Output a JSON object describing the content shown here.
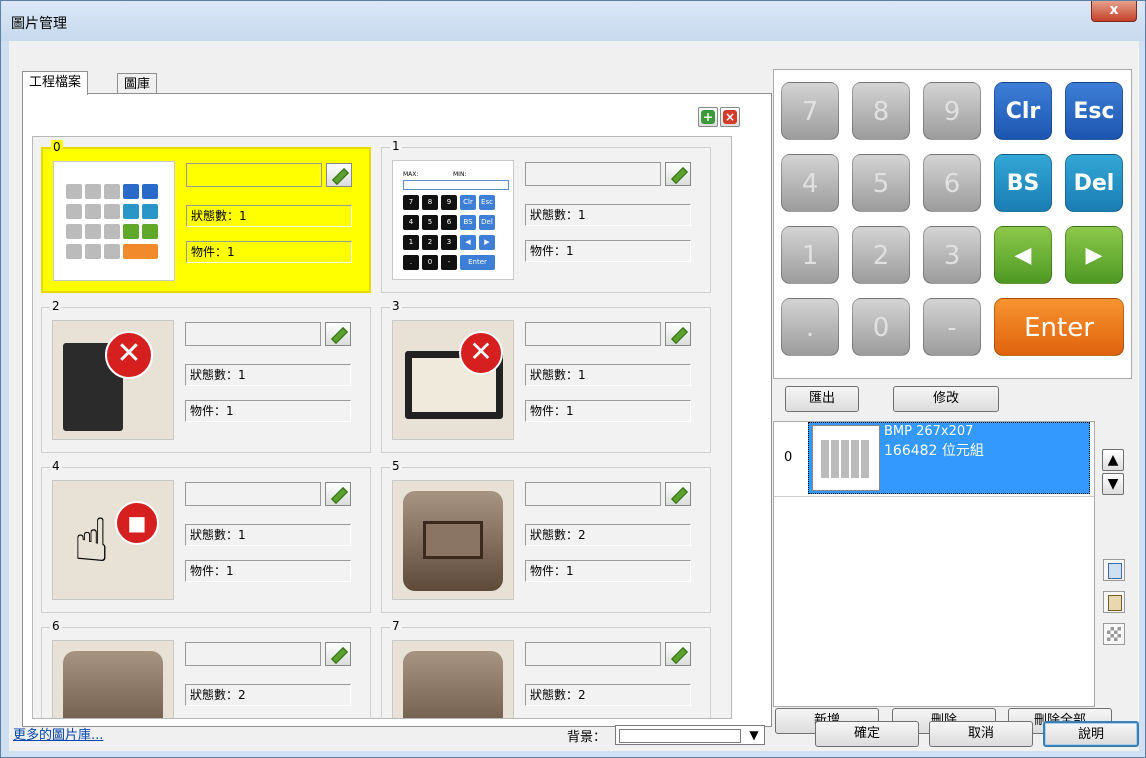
{
  "window": {
    "title": "圖片管理",
    "close_label": "x"
  },
  "tabs": [
    {
      "label": "工程檔案",
      "active": true
    },
    {
      "label": "圖庫",
      "active": false
    }
  ],
  "toolbar": {
    "add_icon": "add-image-icon",
    "remove_icon": "remove-image-icon"
  },
  "cards": [
    {
      "num": "0",
      "state_label": "狀態數：1",
      "object_label": "物件：1",
      "selected": true,
      "thumb": "keypad-gray"
    },
    {
      "num": "1",
      "state_label": "狀態數：1",
      "object_label": "物件：1",
      "selected": false,
      "thumb": "keypad-black"
    },
    {
      "num": "2",
      "state_label": "狀態數：1",
      "object_label": "物件：1",
      "selected": false,
      "thumb": "device-error"
    },
    {
      "num": "3",
      "state_label": "狀態數：1",
      "object_label": "物件：1",
      "selected": false,
      "thumb": "monitor-error"
    },
    {
      "num": "4",
      "state_label": "狀態數：1",
      "object_label": "物件：1",
      "selected": false,
      "thumb": "hand-lock"
    },
    {
      "num": "5",
      "state_label": "狀態數：2",
      "object_label": "物件：1",
      "selected": false,
      "thumb": "brown-button"
    },
    {
      "num": "6",
      "state_label": "狀態數：2",
      "object_label": "",
      "selected": false,
      "thumb": "brown-button-partial"
    },
    {
      "num": "7",
      "state_label": "狀態數：2",
      "object_label": "",
      "selected": false,
      "thumb": "brown-button-partial"
    }
  ],
  "thumb_keypad_black": {
    "label1": "MAX:",
    "label2": "MIN:",
    "keys": [
      "7",
      "8",
      "9",
      "Clr",
      "Esc",
      "4",
      "5",
      "6",
      "BS",
      "Del",
      "1",
      "2",
      "3",
      "◀",
      "▶",
      ".",
      "0",
      "-",
      "Enter"
    ]
  },
  "preview": {
    "keys": [
      {
        "label": "7",
        "style": "gray"
      },
      {
        "label": "8",
        "style": "gray"
      },
      {
        "label": "9",
        "style": "gray"
      },
      {
        "label": "Clr",
        "style": "blue"
      },
      {
        "label": "Esc",
        "style": "blue"
      },
      {
        "label": "4",
        "style": "gray"
      },
      {
        "label": "5",
        "style": "gray"
      },
      {
        "label": "6",
        "style": "gray"
      },
      {
        "label": "BS",
        "style": "teal"
      },
      {
        "label": "Del",
        "style": "teal"
      },
      {
        "label": "1",
        "style": "gray"
      },
      {
        "label": "2",
        "style": "gray"
      },
      {
        "label": "3",
        "style": "gray"
      },
      {
        "label": "◀",
        "style": "green"
      },
      {
        "label": "▶",
        "style": "green"
      },
      {
        "label": ".",
        "style": "gray"
      },
      {
        "label": "0",
        "style": "gray"
      },
      {
        "label": "-",
        "style": "gray"
      },
      {
        "label": "Enter",
        "style": "orange"
      }
    ]
  },
  "buttons": {
    "export": "匯出",
    "modify": "修改",
    "add": "新增",
    "delete": "刪除",
    "delete_all": "刪除全部",
    "ok": "確定",
    "cancel": "取消",
    "help": "說明"
  },
  "image_list": {
    "items": [
      {
        "index": "0",
        "info_line1": "BMP 267x207",
        "info_line2": "166482 位元組",
        "selected": true
      }
    ],
    "up_icon": "▲",
    "down_icon": "▼"
  },
  "footer": {
    "more_link": "更多的圖片庫...",
    "background_label": "背景："
  },
  "colors": {
    "selection_yellow": "#ffff00",
    "list_selection_blue": "#3399ff",
    "link_blue": "#0645ad"
  }
}
